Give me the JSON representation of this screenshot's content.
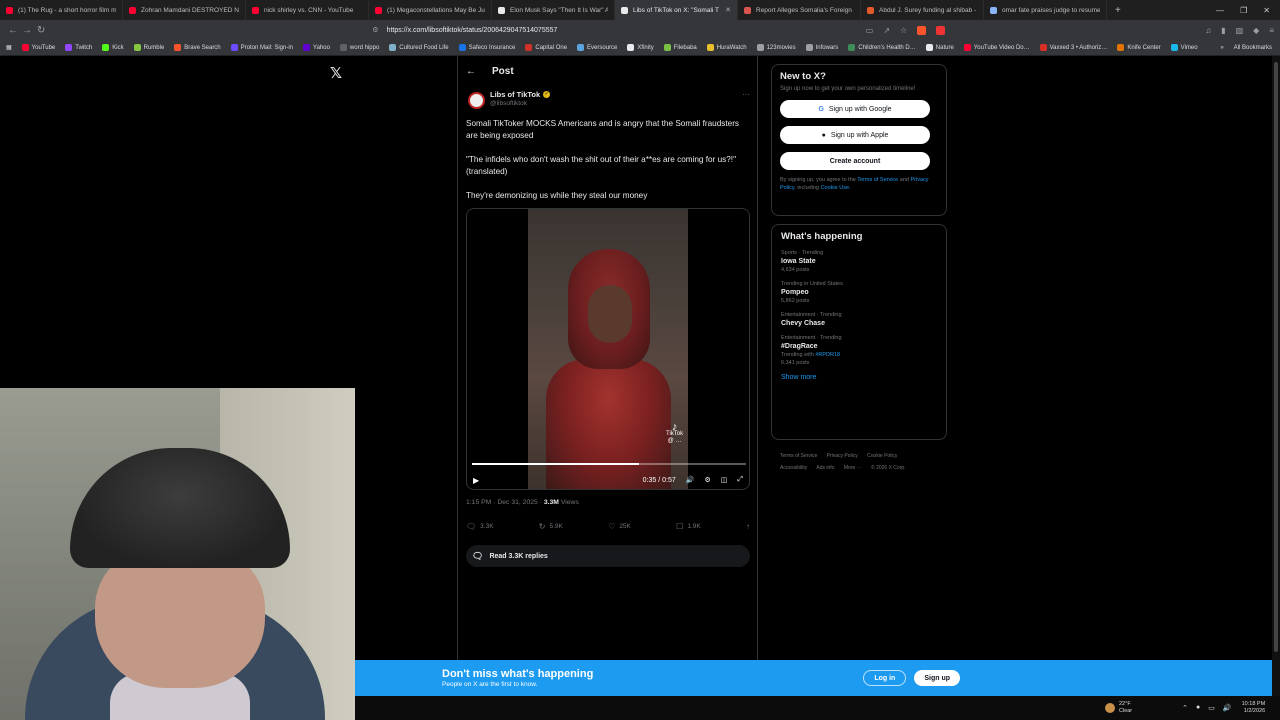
{
  "browser": {
    "tabs": [
      {
        "title": "(1) The Rug - a short horror film mad",
        "color": "#ff0033"
      },
      {
        "title": "Zohran Mamdani DESTROYED New …",
        "color": "#ff0033"
      },
      {
        "title": "nick shirley vs. CNN - YouTube",
        "color": "#ff0033"
      },
      {
        "title": "(1) Megaconstellations May Be Just …",
        "color": "#ff0033"
      },
      {
        "title": "Elon Musk Says \"Then It Is War\" After",
        "color": "#e7e9ea"
      },
      {
        "title": "Libs of TikTok on X: \"Somali Tik",
        "color": "#e7e9ea"
      },
      {
        "title": "Report Alleges Somalia's Foreign Mi",
        "color": "#d9534f"
      },
      {
        "title": "Abdul J. Surey funding al shibab - B",
        "color": "#e05a2b"
      },
      {
        "title": "omar fate praises judge to resume fu",
        "color": "#8ab4f8"
      }
    ],
    "url": "https://x.com/libsoftiktok/status/2006429047514075557",
    "bookmarks": [
      {
        "label": "YouTube",
        "color": "#ff0033"
      },
      {
        "label": "Twitch",
        "color": "#9146ff"
      },
      {
        "label": "Kick",
        "color": "#53fc18"
      },
      {
        "label": "Rumble",
        "color": "#85c742"
      },
      {
        "label": "Brave Search",
        "color": "#fb542b"
      },
      {
        "label": "Proton Mail: Sign-in",
        "color": "#6d4aff"
      },
      {
        "label": "Yahoo",
        "color": "#6001d2"
      },
      {
        "label": "word hippo",
        "color": "#5f6368"
      },
      {
        "label": "Cultured Food Life",
        "color": "#7fb2c9"
      },
      {
        "label": "Safeco Insurance",
        "color": "#1a73e8"
      },
      {
        "label": "Capital One",
        "color": "#d03027"
      },
      {
        "label": "Eversource",
        "color": "#5ba3dd"
      },
      {
        "label": "Xfinity",
        "color": "#e8eaed"
      },
      {
        "label": "Filebaba",
        "color": "#7ac143"
      },
      {
        "label": "HuraWatch",
        "color": "#e7c02b"
      },
      {
        "label": "123movies",
        "color": "#9aa0a6"
      },
      {
        "label": "Infowars",
        "color": "#9aa0a6"
      },
      {
        "label": "Children's Health D…",
        "color": "#3c8d5a"
      },
      {
        "label": "Nature",
        "color": "#e8eaed"
      },
      {
        "label": "YouTube Video Do…",
        "color": "#ff0033"
      },
      {
        "label": "Vaxxed 3 • Authoriz…",
        "color": "#d93025"
      },
      {
        "label": "Knife Center",
        "color": "#e37400"
      },
      {
        "label": "Vimeo",
        "color": "#1ab7ea"
      }
    ],
    "all_bookmarks": "All Bookmarks"
  },
  "post": {
    "header": "Post",
    "author_name": "Libs of TikTok",
    "author_handle": "@libsoftiktok",
    "text_1": "Somali TikToker MOCKS Americans and is angry that the Somali fraudsters are being exposed",
    "text_2": "\"The infidels who don't wash the shit out of their a**es are coming for us?!\" (translated)",
    "text_3": "They're demonizing us while they steal our money",
    "video": {
      "time": "0:35 / 0:57",
      "progress": 0.61,
      "watermark": "TikTok",
      "watermark_handle": "@ …"
    },
    "timestamp": "1:15 PM · Dec 31, 2025",
    "views_count": "3.3M",
    "views_label": "Views",
    "replies": "3.3K",
    "reposts": "5.9K",
    "likes": "25K",
    "bookmarks": "1.9K",
    "read_replies": "Read 3.3K replies"
  },
  "sidebar": {
    "new_to_x": {
      "title": "New to X?",
      "subtitle": "Sign up now to get your own personalized timeline!",
      "google": "Sign up with Google",
      "apple": "Sign up with Apple",
      "create": "Create account",
      "legal_1": "By signing up, you agree to the",
      "tos": "Terms of Service",
      "legal_2": "and",
      "privacy": "Privacy Policy",
      "legal_3": ", including",
      "cookie": "Cookie Use."
    },
    "happening": {
      "title": "What's happening",
      "trends": [
        {
          "context": "Sports · Trending",
          "name": "Iowa State",
          "count": "4,634 posts"
        },
        {
          "context": "Trending in United States",
          "name": "Pompeo",
          "count": "5,862 posts"
        },
        {
          "context": "Entertainment · Trending",
          "name": "Chevy Chase",
          "count": ""
        },
        {
          "context": "Entertainment · Trending",
          "name": "#DragRace",
          "with_label": "Trending with",
          "with_tag": "#RPDR18",
          "count": "6,341 posts"
        }
      ],
      "show_more": "Show more"
    },
    "footer": [
      "Terms of Service",
      "Privacy Policy",
      "Cookie Policy",
      "Accessibility",
      "Ads info",
      "More ···",
      "© 2026 X Corp."
    ]
  },
  "banner": {
    "title": "Don't miss what's happening",
    "subtitle": "People on X are the first to know.",
    "login": "Log in",
    "signup": "Sign up"
  },
  "taskbar": {
    "temp": "22°F",
    "condition": "Clear",
    "time": "10:18 PM",
    "date": "1/2/2026"
  }
}
